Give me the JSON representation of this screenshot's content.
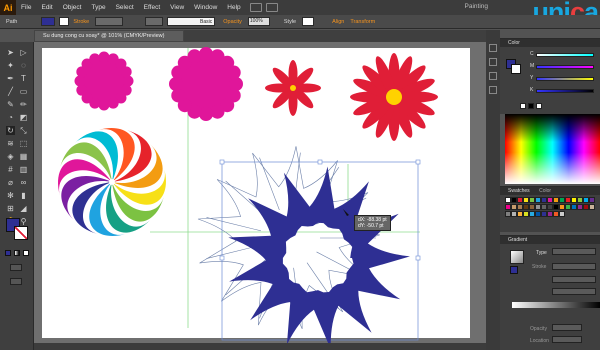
{
  "app": {
    "logo": "Ai",
    "watermark": "Painting"
  },
  "brand": {
    "prefix": "uni",
    "accent": "c",
    "suffix": "a",
    "colors": {
      "blue": "#18a7e0",
      "red": "#e83e3e"
    }
  },
  "menu": [
    "File",
    "Edit",
    "Object",
    "Type",
    "Select",
    "Effect",
    "View",
    "Window",
    "Help"
  ],
  "control": {
    "selection": "Path",
    "stroke_label": "Stroke",
    "brush": "Basic",
    "opacity_label": "Opacity",
    "opacity_value": "100%",
    "style_label": "Style",
    "align_label": "Align",
    "transform_label": "Transform"
  },
  "document": {
    "tab_title": "Su dung cong cu xoay* @ 101% (CMYK/Preview)"
  },
  "tooltip": {
    "dx": "dX: -88.38 pt",
    "dy": "dY: -50.7 pt"
  },
  "panels": {
    "color": {
      "title": "Color",
      "channels": [
        "C",
        "M",
        "Y",
        "K"
      ]
    },
    "swatches": {
      "title": "Swatches",
      "tab2": "Color"
    },
    "gradient": {
      "title": "Gradient",
      "type_label": "Type",
      "stroke_label": "Stroke",
      "opacity_label": "Opacity",
      "location_label": "Location"
    }
  },
  "colors": {
    "magenta": "#e0169a",
    "crimson": "#e01e37",
    "navy": "#2e2f93",
    "yellow": "#ffd200",
    "guide": "#8fdc8f"
  }
}
